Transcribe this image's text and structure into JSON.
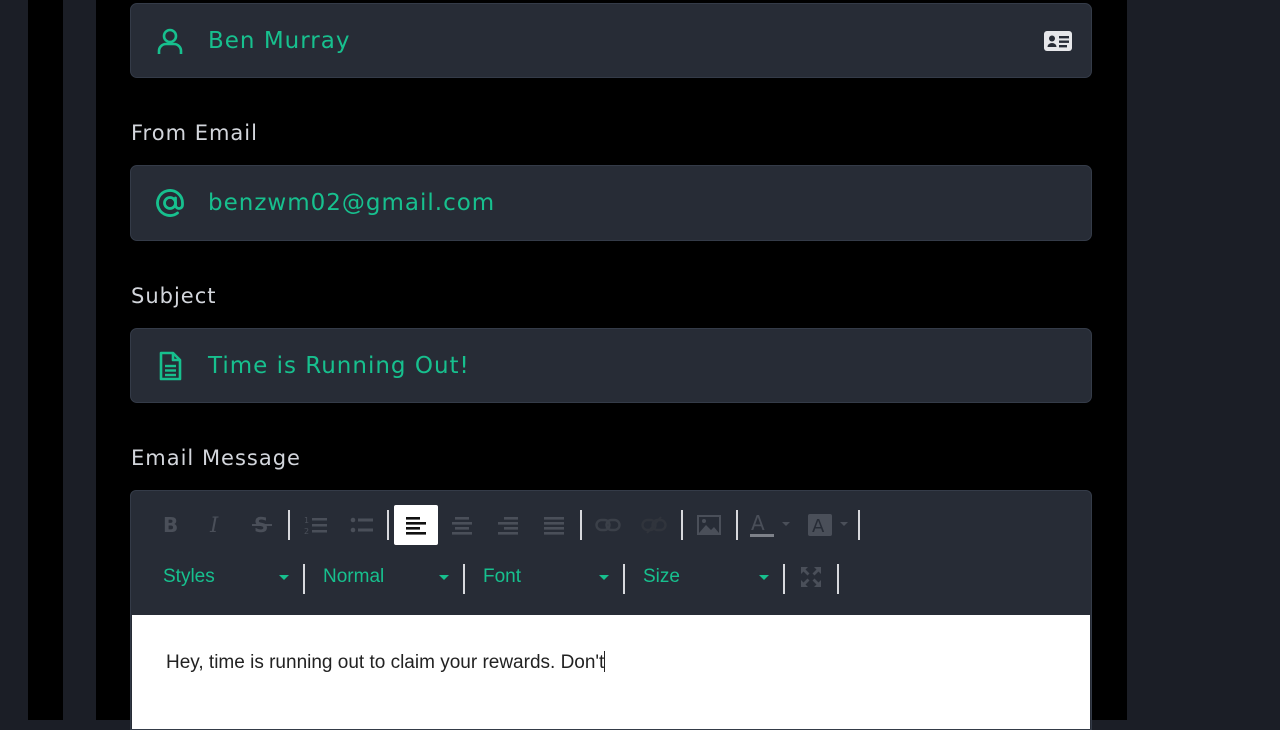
{
  "from_name": {
    "value": "Ben Murray",
    "icon": "user-icon",
    "right_icon": "contact-card-icon"
  },
  "from_email": {
    "label": "From Email",
    "value": "benzwm02@gmail.com",
    "icon": "at-sign-icon"
  },
  "subject": {
    "label": "Subject",
    "value": "Time is Running Out!",
    "icon": "document-icon"
  },
  "email_message": {
    "label": "Email Message",
    "toolbar": {
      "buttons": [
        "bold",
        "italic",
        "strikethrough",
        "numbered-list",
        "bulleted-list",
        "align-left",
        "align-center",
        "align-right",
        "justify",
        "link",
        "unlink",
        "image",
        "text-color",
        "background-color",
        "maximize"
      ],
      "active_button": "align-left",
      "styles_combo": "Styles",
      "format_combo": "Normal",
      "font_combo": "Font",
      "size_combo": "Size"
    },
    "body_text": "Hey, time is running out to claim your rewards. Don't"
  },
  "colors": {
    "accent": "#17c08e",
    "field_bg": "#272c36",
    "panel_bg": "#000000",
    "page_bg": "#1b1e26"
  }
}
